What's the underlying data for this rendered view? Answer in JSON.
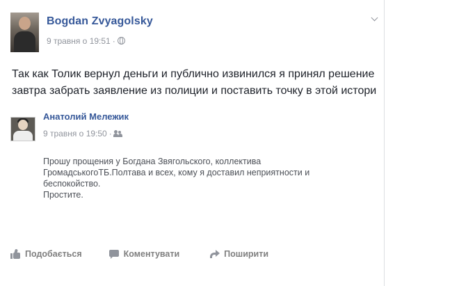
{
  "post": {
    "author": "Bogdan Zvyagolsky",
    "timestamp": "9 травня о 19:51",
    "separator": "·",
    "privacy_icon": "globe-icon",
    "options_icon": "chevron-down-icon",
    "text_line1": "Так как Толик вернул деньги и публично извинился я принял решение",
    "text_line2": "завтра забрать заявление из полиции и поставить точку в этой истори"
  },
  "shared_post": {
    "author": "Анатолий Мележик",
    "timestamp": "9 травня о 19:50",
    "separator": "·",
    "privacy_icon": "friends-icon",
    "text_line1": "Прошу прощения у Богдана Звягольского, коллектива",
    "text_line2": "ГромадськогоТБ.Полтава и всех, кому я доставил неприятности и",
    "text_line3": "беспокойство.",
    "text_line4": "Простите."
  },
  "actions": {
    "like_label": "Подобається",
    "comment_label": "Коментувати",
    "share_label": "Поширити"
  },
  "colors": {
    "link": "#365899",
    "meta": "#90949c",
    "text": "#1d2129",
    "action": "#7f7f7f"
  }
}
